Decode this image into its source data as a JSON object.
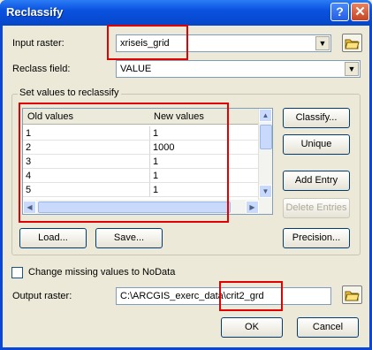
{
  "window": {
    "title": "Reclassify",
    "help_icon_text": "?",
    "close_icon_text": "✕"
  },
  "input_raster": {
    "label": "Input raster:",
    "value": "xriseis_grid"
  },
  "reclass_field": {
    "label": "Reclass field:",
    "value": "VALUE"
  },
  "group": {
    "title": "Set values to reclassify"
  },
  "table": {
    "headers": [
      "Old values",
      "New values"
    ],
    "rows": [
      [
        "1",
        "1"
      ],
      [
        "2",
        "1000"
      ],
      [
        "3",
        "1"
      ],
      [
        "4",
        "1"
      ],
      [
        "5",
        "1"
      ]
    ]
  },
  "side_buttons": {
    "classify": "Classify...",
    "unique": "Unique",
    "add_entry": "Add Entry",
    "delete_entries": "Delete Entries",
    "precision": "Precision..."
  },
  "bottom_buttons": {
    "load": "Load...",
    "save": "Save..."
  },
  "nodata": {
    "label": "Change missing values to NoData"
  },
  "output_raster": {
    "label": "Output raster:",
    "value": "C:\\ARCGIS_exerc_data\\crit2_grd"
  },
  "actions": {
    "ok": "OK",
    "cancel": "Cancel"
  }
}
